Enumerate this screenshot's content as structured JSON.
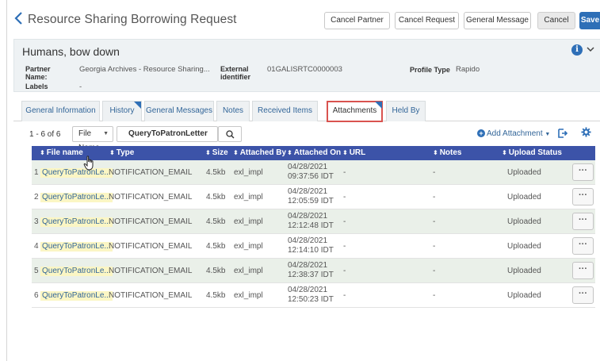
{
  "header": {
    "title": "Resource Sharing Borrowing Request",
    "buttons": {
      "cancel_partner": "Cancel Partner",
      "cancel_request": "Cancel Request",
      "general_message": "General Message",
      "cancel": "Cancel",
      "save": "Save"
    }
  },
  "summary": {
    "title": "Humans, bow down",
    "partner_name_label": "Partner Name:",
    "partner_name_value": "Georgia Archives - Resource Sharing...",
    "external_identifier_label": "External identifier",
    "external_identifier_value": "01GALISRTC0000003",
    "profile_type_label": "Profile Type",
    "profile_type_value": "Rapido",
    "labels_label": "Labels",
    "labels_value": "-"
  },
  "tabs": [
    {
      "label": "General Information",
      "active": false
    },
    {
      "label": "History",
      "active": false
    },
    {
      "label": "General Messages",
      "active": false
    },
    {
      "label": "Notes",
      "active": false
    },
    {
      "label": "Received Items",
      "active": false
    },
    {
      "label": "Attachments",
      "active": true
    },
    {
      "label": "Held By",
      "active": false
    }
  ],
  "toolbar": {
    "count": "1 - 6 of 6",
    "filter_field": "File Name",
    "filter_value": "QueryToPatronLetter",
    "add_attachment": "Add Attachment"
  },
  "table": {
    "columns": [
      "File name",
      "Type",
      "Size",
      "Attached By",
      "Attached On",
      "URL",
      "Notes",
      "Upload Status"
    ],
    "rows": [
      {
        "num": "1",
        "file": "QueryToPatronLe...",
        "type": "NOTIFICATION_EMAIL",
        "size": "4.5kb",
        "by": "exl_impl",
        "date": "04/28/2021",
        "time": "09:37:56 IDT",
        "url": "-",
        "notes": "-",
        "status": "Uploaded"
      },
      {
        "num": "2",
        "file": "QueryToPatronLe...",
        "type": "NOTIFICATION_EMAIL",
        "size": "4.5kb",
        "by": "exl_impl",
        "date": "04/28/2021",
        "time": "12:05:59 IDT",
        "url": "-",
        "notes": "-",
        "status": "Uploaded"
      },
      {
        "num": "3",
        "file": "QueryToPatronLe...",
        "type": "NOTIFICATION_EMAIL",
        "size": "4.5kb",
        "by": "exl_impl",
        "date": "04/28/2021",
        "time": "12:12:48 IDT",
        "url": "-",
        "notes": "-",
        "status": "Uploaded"
      },
      {
        "num": "4",
        "file": "QueryToPatronLe...",
        "type": "NOTIFICATION_EMAIL",
        "size": "4.5kb",
        "by": "exl_impl",
        "date": "04/28/2021",
        "time": "12:14:10 IDT",
        "url": "-",
        "notes": "-",
        "status": "Uploaded"
      },
      {
        "num": "5",
        "file": "QueryToPatronLe...",
        "type": "NOTIFICATION_EMAIL",
        "size": "4.5kb",
        "by": "exl_impl",
        "date": "04/28/2021",
        "time": "12:38:37 IDT",
        "url": "-",
        "notes": "-",
        "status": "Uploaded"
      },
      {
        "num": "6",
        "file": "QueryToPatronLe...",
        "type": "NOTIFICATION_EMAIL",
        "size": "4.5kb",
        "by": "exl_impl",
        "date": "04/28/2021",
        "time": "12:50:23 IDT",
        "url": "-",
        "notes": "-",
        "status": "Uploaded"
      }
    ]
  },
  "icons": {
    "back": "chevron-left-icon",
    "info": "info-icon",
    "collapse": "chevron-down-icon",
    "search": "search-icon",
    "add": "plus-circle-icon",
    "export": "export-icon",
    "settings": "gear-icon",
    "row_actions": "ellipsis-icon"
  },
  "colors": {
    "accent": "#2e6fb7",
    "table_header": "#3c53a8",
    "active_tab_border": "#d9534f",
    "row_highlight": "#eaf0e9"
  }
}
